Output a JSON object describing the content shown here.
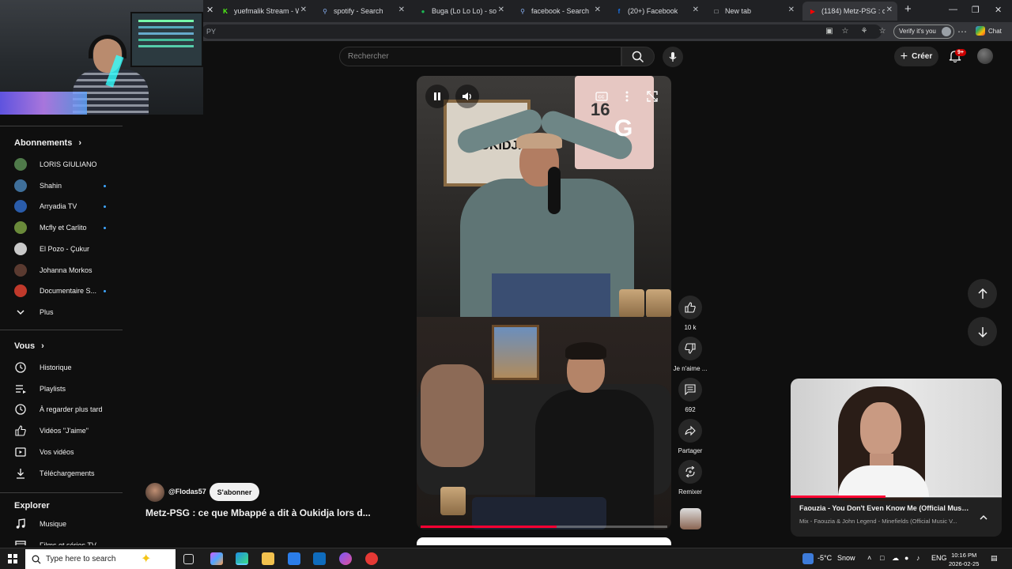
{
  "browser": {
    "tabs": [
      {
        "title": "yuefmalik Stream - Watc",
        "favicon": "kick-icon",
        "color": "#53fc18"
      },
      {
        "title": "spotify - Search",
        "favicon": "search-icon",
        "color": "#8ab4f8"
      },
      {
        "title": "Buga (Lo Lo Lo) - song a",
        "favicon": "spotify-icon",
        "color": "#1db954"
      },
      {
        "title": "facebook - Search",
        "favicon": "search-icon",
        "color": "#8ab4f8"
      },
      {
        "title": "(20+) Facebook",
        "favicon": "facebook-icon",
        "color": "#1877f2"
      },
      {
        "title": "New tab",
        "favicon": "page-icon",
        "color": "#dadce0"
      },
      {
        "title": "(1184) Metz-PSG : c",
        "favicon": "youtube-icon",
        "color": "#ff0000",
        "active": true
      }
    ],
    "address_text": "PY",
    "verify_label": "Verify it's you",
    "chat_label": "Chat"
  },
  "sidebar": {
    "subscriptions_heading": "Abonnements",
    "subscriptions": [
      {
        "name": "LORIS GIULIANO",
        "dot": false,
        "color": "#4f7a4a"
      },
      {
        "name": "Shahin",
        "dot": true,
        "color": "#3f6f9a"
      },
      {
        "name": "Arryadia TV",
        "dot": true,
        "color": "#2a5caa"
      },
      {
        "name": "Mcfly et Carlito",
        "dot": true,
        "color": "#6a8a3a"
      },
      {
        "name": "El Pozo - Çukur",
        "dot": false,
        "color": "#c9c9c9"
      },
      {
        "name": "Johanna Morkos",
        "dot": false,
        "color": "#5a3a30"
      },
      {
        "name": "Documentaire S...",
        "dot": true,
        "color": "#c0392b"
      }
    ],
    "more_label": "Plus",
    "you_heading": "Vous",
    "you_items": [
      {
        "label": "Historique",
        "icon": "history-icon"
      },
      {
        "label": "Playlists",
        "icon": "playlists-icon"
      },
      {
        "label": "À regarder plus tard",
        "icon": "watch-later-icon"
      },
      {
        "label": "Vidéos \"J'aime\"",
        "icon": "thumb-up-icon"
      },
      {
        "label": "Vos vidéos",
        "icon": "your-videos-icon"
      },
      {
        "label": "Téléchargements",
        "icon": "download-icon"
      }
    ],
    "explore_heading": "Explorer",
    "explore_items": [
      {
        "label": "Musique",
        "icon": "music-icon"
      },
      {
        "label": "Films et séries TV",
        "icon": "films-icon"
      }
    ]
  },
  "header": {
    "search_placeholder": "Rechercher",
    "create_label": "Créer",
    "notifications_badge": "9+"
  },
  "short": {
    "frame_text": "OUKIDJA",
    "jersey_text": "16",
    "watermark_text": "G",
    "progress": 0.55
  },
  "actions": {
    "like_count": "10 k",
    "dislike_label": "Je n'aime ...",
    "comments_count": "692",
    "share_label": "Partager",
    "remix_label": "Remixer"
  },
  "channel": {
    "handle": "@Flodas57",
    "subscribe_label": "S'abonner",
    "title": "Metz-PSG : ce que Mbappé a dit à Oukidja lors d..."
  },
  "miniplayer": {
    "title": "Faouzia - You Don't Even Know Me (Official Musi...",
    "subtitle": "Mix - Faouzia & John Legend - Minefields (Official Music V...",
    "progress": 0.45
  },
  "taskbar": {
    "search_placeholder": "Type here to search",
    "weather_temp": "-5°C",
    "weather_desc": "Snow",
    "language": "ENG",
    "time": "10:16 PM",
    "date": "2026-02-25"
  },
  "colors": {
    "accent_red": "#ff0033",
    "badge_red": "#cc0000",
    "background": "#0f0f0f"
  }
}
